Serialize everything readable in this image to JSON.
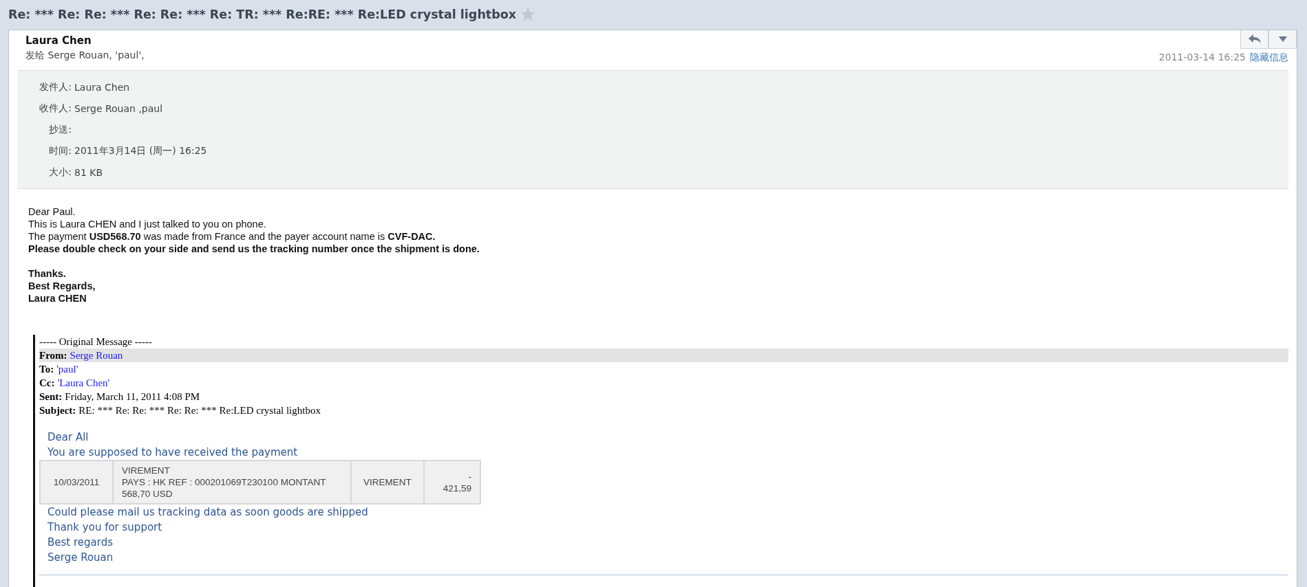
{
  "window": {
    "title": "Re: *** Re: Re: *** Re: Re: *** Re: TR: *** Re:RE: *** Re:LED crystal lightbox"
  },
  "header": {
    "sender": "Laura Chen",
    "recipients": "发给 Serge Rouan, 'paul',",
    "date": "2011-03-14 16:25",
    "toggle_link": "隐藏信息"
  },
  "details": [
    {
      "label": "发件人:",
      "value": "Laura Chen"
    },
    {
      "label": "收件人:",
      "value": "Serge Rouan ,paul"
    },
    {
      "label": "抄送:"
    },
    {
      "label": "时间:",
      "value": "2011年3月14日 (周一) 16:25"
    },
    {
      "label": "大小:",
      "value": "81 KB"
    }
  ],
  "body": [
    [
      {
        "text": "Dear Paul.",
        "bold": false
      },
      {
        "text": "This is Laura CHEN and I just talked to you on phone.",
        "bold": false
      },
      {
        "text": "The payment **USD568.70** was made from France and the payer account name is **CVF-DAC.**",
        "bold": false
      },
      {
        "text": "Please double check on your side and send us the tracking number once the shipment is done.",
        "bold": true
      }
    ],
    [
      {
        "text": "Thanks.",
        "bold": true
      },
      {
        "text": "Best Regards,",
        "bold": true
      },
      {
        "text": "Laura CHEN",
        "bold": true
      }
    ]
  ],
  "quoted": {
    "heading": "----- Original Message -----",
    "fields": [
      {
        "label": "From:",
        "value": "Serge Rouan",
        "link": true,
        "highlighted": true
      },
      {
        "label": "To:",
        "value": "'paul'",
        "link": true,
        "highlighted": false
      },
      {
        "label": "Cc:",
        "value": "'Laura Chen'",
        "link": true,
        "highlighted": false
      },
      {
        "label": "Sent:",
        "value": "Friday, March 11, 2011 4:08 PM",
        "link": false,
        "highlighted": false
      },
      {
        "label": "Subject:",
        "value": "RE: *** Re: Re: *** Re: Re: *** Re:LED crystal lightbox",
        "link": false,
        "highlighted": false
      }
    ],
    "intro": [
      "Dear All",
      "You are supposed to have received the payment"
    ],
    "table": {
      "rows": [
        [
          "10/03/2011",
          "VIREMENT\nPAYS : HK REF : 000201069T230100 MONTANT 568,70 USD",
          "VIREMENT",
          "-\n421,59"
        ]
      ]
    },
    "closing": [
      "Could please mail us tracking data as soon goods are shipped",
      "Thank you for support",
      "Best regards",
      "Serge Rouan"
    ]
  }
}
